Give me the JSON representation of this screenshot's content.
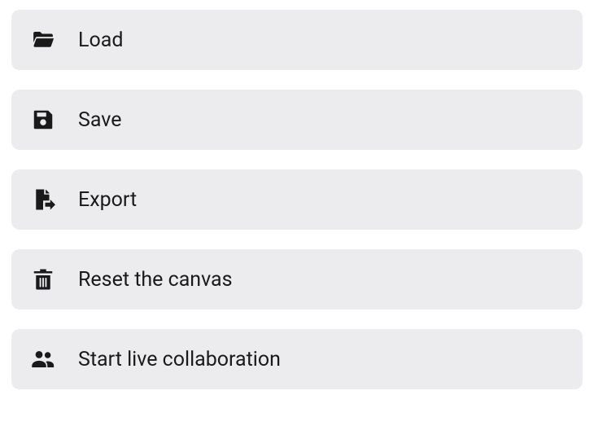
{
  "menu": {
    "items": [
      {
        "id": "load",
        "label": "Load",
        "icon": "folder-open-icon"
      },
      {
        "id": "save",
        "label": "Save",
        "icon": "save-icon"
      },
      {
        "id": "export",
        "label": "Export",
        "icon": "export-icon"
      },
      {
        "id": "reset",
        "label": "Reset the canvas",
        "icon": "trash-icon"
      },
      {
        "id": "collab",
        "label": "Start live collaboration",
        "icon": "users-icon"
      }
    ]
  }
}
